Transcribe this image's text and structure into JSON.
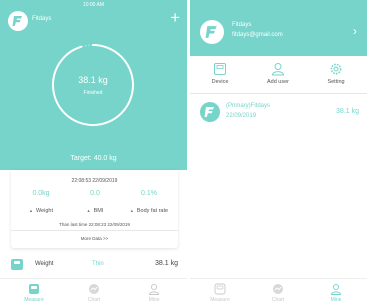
{
  "left": {
    "status_time": "10:00 AM",
    "username": "Fitdays",
    "ring": {
      "weight": "38.1 kg",
      "status": "Finished",
      "progress": 0.95
    },
    "target": "Target: 40.0 kg",
    "card": {
      "timestamp": "22:08:53 22/09/2019",
      "metrics": [
        {
          "value": "0.0kg",
          "label": "Weight"
        },
        {
          "value": "0.0",
          "label": "BMI"
        },
        {
          "value": "0.1%",
          "label": "Body fat rate"
        }
      ],
      "last_time": "Than last time 22:08:23 22/09/2019",
      "more": "More Data >>"
    },
    "weight_row": {
      "label": "Weight",
      "status": "Thin",
      "value": "38.1 kg"
    },
    "tabs": [
      {
        "label": "Measure",
        "icon": "scale-icon"
      },
      {
        "label": "Chart",
        "icon": "chart-icon"
      },
      {
        "label": "Mine",
        "icon": "person-icon"
      }
    ],
    "active_tab": "Measure"
  },
  "right": {
    "profile": {
      "name": "Fitdays",
      "email": "fitdays@gmail.com"
    },
    "actions": [
      {
        "label": "Device",
        "icon": "device-icon"
      },
      {
        "label": "Add user",
        "icon": "add-user-icon"
      },
      {
        "label": "Setting",
        "icon": "settings-gear-icon"
      }
    ],
    "user_entry": {
      "name": "(Primary)Fitdays",
      "date": "22/09/2019",
      "weight": "38.1 kg"
    },
    "tabs": [
      {
        "label": "Measure",
        "icon": "scale-icon"
      },
      {
        "label": "Chart",
        "icon": "chart-icon"
      },
      {
        "label": "Mine",
        "icon": "person-icon"
      }
    ],
    "active_tab": "Mine"
  },
  "colors": {
    "accent": "#76d4ca",
    "text": "#444444",
    "muted": "#c8c8c8"
  }
}
